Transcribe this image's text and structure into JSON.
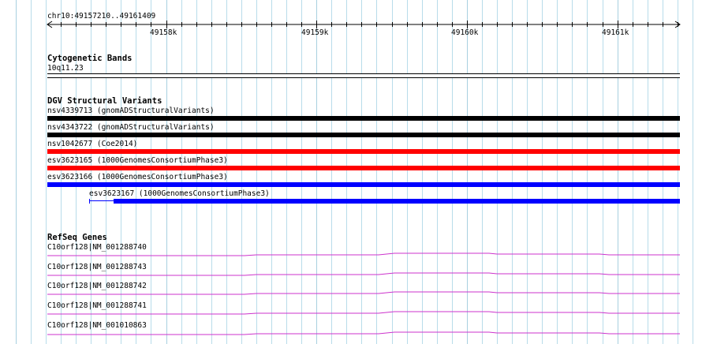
{
  "locus": "chr10:49157210..49161409",
  "ruler": {
    "ticks": [
      "49158k",
      "49159k",
      "49160k",
      "49161k"
    ]
  },
  "tracks": {
    "cytoband": {
      "title": "Cytogenetic Bands",
      "band": "10q11.23"
    },
    "dgv": {
      "title": "DGV Structural Variants",
      "variants": [
        {
          "label": "nsv4339713 (gnomADStructuralVariants)",
          "color": "#000000"
        },
        {
          "label": "nsv4343722 (gnomADStructuralVariants)",
          "color": "#000000"
        },
        {
          "label": "nsv1042677 (Coe2014)",
          "color": "#ff0000"
        },
        {
          "label": "esv3623165 (1000GenomesConsortiumPhase3)",
          "color": "#ff0000"
        },
        {
          "label": "esv3623166 (1000GenomesConsortiumPhase3)",
          "color": "#0000ff"
        },
        {
          "label": "esv3623167 (1000GenomesConsortiumPhase3)",
          "color": "#0000ff"
        }
      ]
    },
    "refseq": {
      "title": "RefSeq Genes",
      "color": "#cc33cc",
      "genes": [
        "C10orf128|NM_001288740",
        "C10orf128|NM_001288743",
        "C10orf128|NM_001288742",
        "C10orf128|NM_001288741",
        "C10orf128|NM_001010863"
      ]
    }
  },
  "colors": {
    "grid_line": "#b8dcea",
    "grid_line_major": "#a8d0e0",
    "ruler": "#000000"
  }
}
